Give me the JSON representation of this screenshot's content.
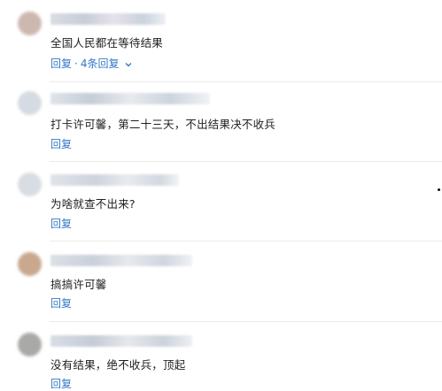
{
  "comments": [
    {
      "avatar_color": "#cdb8b0",
      "name_gradient": "linear-gradient(90deg,#d9dde3 0%,#c7ced8 30%,#e6e2ea 55%,#c9d2dd 80%,#eef0f3 100%)",
      "text": "全国人民都在等待结果",
      "reply_label": "回复",
      "separator": "·",
      "more_replies_label": "4条回复"
    },
    {
      "avatar_color": "#d5dbe2",
      "name_gradient": "linear-gradient(90deg,#dfe4ea 0%,#c6cdd6 25%,#e8eaee 50%,#cdd4dd 75%,#f0f2f5 100%)",
      "text": "打卡许可馨，第二十三天，不出结果决不收兵",
      "reply_label": "回复"
    },
    {
      "avatar_color": "#d8dde3",
      "name_gradient": "linear-gradient(90deg,#e0e4ea 0%,#cdd3dc 35%,#e9ebef 60%,#d2d8e0 85%,#f1f3f6 100%)",
      "text": "为啥就查不出来?",
      "reply_label": "回复"
    },
    {
      "avatar_color": "#c9a88e",
      "name_gradient": "linear-gradient(90deg,#dce0e6 0%,#c9d0da 30%,#e7e9ed 55%,#cfd6df 80%,#f0f2f5 100%)",
      "text": "搞搞许可馨",
      "reply_label": "回复"
    },
    {
      "avatar_color": "#a9aaa8",
      "name_gradient": "linear-gradient(90deg,#d9dee5 0%,#c5ccd6 30%,#e6e8ec 55%,#ccd3dc 80%,#eef0f3 100%)",
      "text": "没有结果，绝不收兵，顶起",
      "reply_label": "回复"
    }
  ]
}
